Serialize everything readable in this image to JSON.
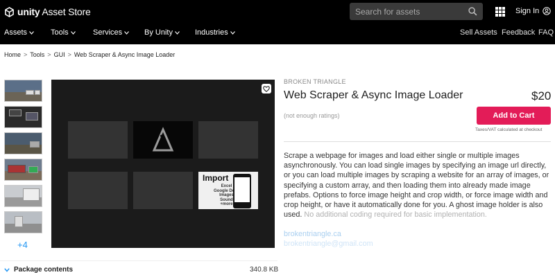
{
  "header": {
    "logo_word": "unity",
    "logo_rest": " Asset Store",
    "search_placeholder": "Search for assets",
    "signin_label": "Sign In"
  },
  "nav": {
    "items": [
      {
        "label": "Assets"
      },
      {
        "label": "Tools"
      },
      {
        "label": "Services"
      },
      {
        "label": "By Unity"
      },
      {
        "label": "Industries"
      }
    ],
    "right": [
      {
        "label": "Sell Assets"
      },
      {
        "label": "Feedback"
      },
      {
        "label": "FAQ"
      }
    ]
  },
  "breadcrumb": [
    "Home",
    "Tools",
    "GUI",
    "Web Scraper & Async Image Loader"
  ],
  "thumbnails": {
    "more_label": "+4"
  },
  "preview": {
    "import_title": "Import",
    "import_list": [
      "Excel",
      "Google Docs",
      "Images",
      "Sound",
      "+more"
    ]
  },
  "product": {
    "publisher": "BROKEN TRIANGLE",
    "title": "Web Scraper & Async Image Loader",
    "price": "$20",
    "ratings": "(not enough ratings)",
    "cart_label": "Add to Cart",
    "tax_note": "Taxes/VAT calculated at checkout",
    "description": "Scrape a webpage for images and load either single or multiple images asynchronously. You can load single images by specifying an image url directly, or you can load multiple images by scraping a website for an array of images, or specifying a custom array, and then loading them into already made image prefabs. Options to force image height and crop width, or force image width and crop height, or have it automatically done for you. A ghost image holder is also used.",
    "description_fade": "No additional coding required for basic implementation.",
    "link1": "brokentriangle.ca",
    "link2": "brokentriangle@gmail.com"
  },
  "package": {
    "label": "Package contents",
    "size": "340.8 KB"
  }
}
